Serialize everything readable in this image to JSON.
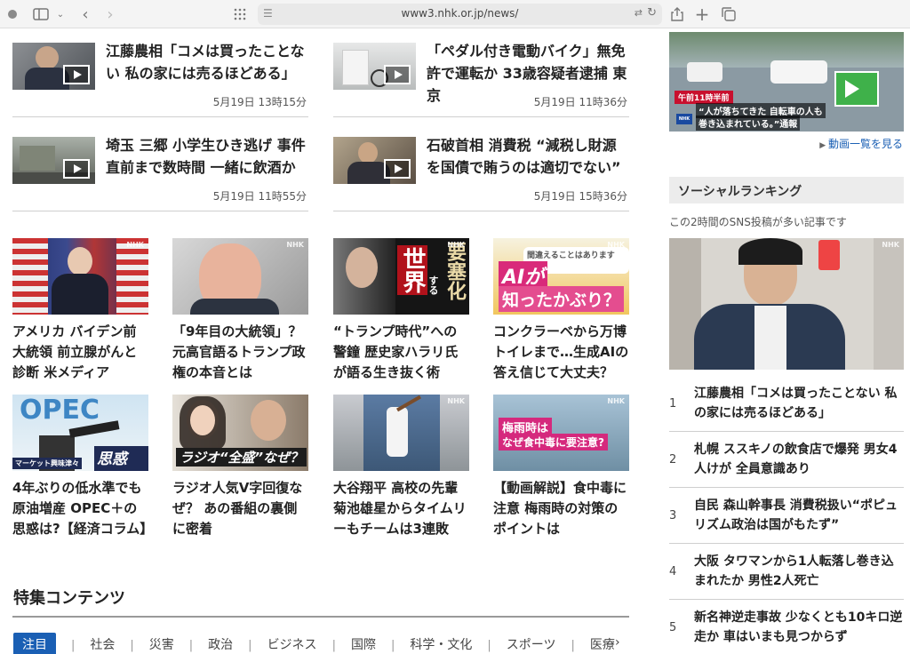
{
  "browser": {
    "url": "www3.nhk.or.jp/news/"
  },
  "top_news": [
    {
      "title": "江藤農相「コメは買ったことない 私の家には売るほどある」",
      "time": "5月19日 13時15分"
    },
    {
      "title": "「ペダル付き電動バイク」無免許で運転か 33歳容疑者逮捕 東京",
      "time": "5月19日 11時36分"
    },
    {
      "title": "埼玉 三郷 小学生ひき逃げ 事件直前まで数時間 一緒に飲酒か",
      "time": "5月19日 11時55分"
    },
    {
      "title": "石破首相 消費税 “減税し財源を国債で賄うのは適切でない”",
      "time": "5月19日 15時36分"
    }
  ],
  "cards": [
    {
      "title": "アメリカ バイデン前大統領 前立腺がんと診断 米メディア"
    },
    {
      "title": "「9年目の大統領」？ 元高官語るトランプ政権の本音とは"
    },
    {
      "title": "“トランプ時代”への警鐘 歴史家ハラリ氏が語る生き抜く術",
      "img_text_1": "世界",
      "img_text_2": "要塞化",
      "img_text_3": "する"
    },
    {
      "title": "コンクラーベから万博トイレまで…生成AIの答え信じて大丈夫？",
      "img_text_1": "間違えることはありますか？",
      "img_text_2": "AIが",
      "img_text_3": "知ったかぶり？"
    },
    {
      "title": "4年ぶりの低水準でも原油増産 OPEC＋の思惑は?【経済コラム】",
      "img_text_1": "OPEC",
      "img_text_2": "思惑は？",
      "img_text_3": "マーケット興味津々"
    },
    {
      "title": "ラジオ人気V字回復なぜ？ あの番組の裏側に密着",
      "img_text_1": "ラジオ“全盛”なぜ？"
    },
    {
      "title": "大谷翔平 高校の先輩 菊池雄星からタイムリーもチームは3連敗"
    },
    {
      "title": "【動画解説】食中毒に注意 梅雨時の対策のポイントは",
      "img_text_1": "梅雨時は",
      "img_text_2": "なぜ食中毒に要注意?"
    }
  ],
  "nhk_mark": "NHK",
  "special": {
    "heading": "特集コンテンツ",
    "tabs": [
      "注目",
      "社会",
      "災害",
      "政治",
      "ビジネス",
      "国際",
      "科学・文化",
      "スポーツ",
      "医療"
    ]
  },
  "sidebar": {
    "video_caption_time": "午前11時半前",
    "video_caption_1": "“人が落ちてきた 自転車の人も",
    "video_caption_2": "巻き込まれている。”通報",
    "video_link": "動画一覧を見る",
    "ranking_heading": "ソーシャルランキング",
    "ranking_sub": "この2時間のSNS投稿が多い記事です",
    "ranking": [
      {
        "num": "1",
        "title": "江藤農相「コメは買ったことない 私の家には売るほどある」"
      },
      {
        "num": "2",
        "title": "札幌 ススキノの飲食店で爆発 男女4人けが 全員意識あり"
      },
      {
        "num": "3",
        "title": "自民 森山幹事長 消費税扱い“ポピュリズム政治は国がもたず”"
      },
      {
        "num": "4",
        "title": "大阪 タワマンから1人転落し巻き込まれたか 男性2人死亡"
      },
      {
        "num": "5",
        "title": "新名神逆走事故 少なくとも10キロ逆走か 車はいまも見つからず"
      }
    ]
  },
  "colors": {
    "link_blue": "#1a5fb4",
    "active_tab": "#1a5fb4"
  },
  "icons": [
    "record-icon",
    "sidebar-icon",
    "chevron-down-icon",
    "back-icon",
    "forward-icon",
    "grid-icon",
    "page-icon",
    "translate-icon",
    "reload-icon",
    "share-icon",
    "plus-icon",
    "tabs-icon",
    "play-icon",
    "chevron-right-icon"
  ]
}
